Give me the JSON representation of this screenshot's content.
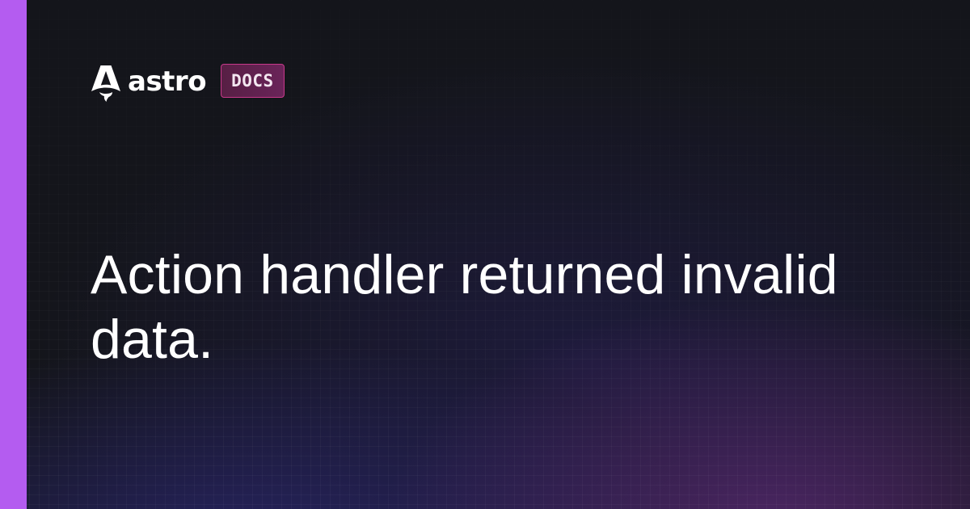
{
  "brand": {
    "logo_icon": "astro-rocket-icon",
    "wordmark": "astro",
    "badge": "DOCS"
  },
  "title": "Action handler returned invalid data.",
  "colors": {
    "accent_bar": "#b45cf0",
    "background": "#14151b",
    "badge_border": "#c7398a",
    "badge_fill": "#5e2150",
    "text": "#ffffff"
  }
}
